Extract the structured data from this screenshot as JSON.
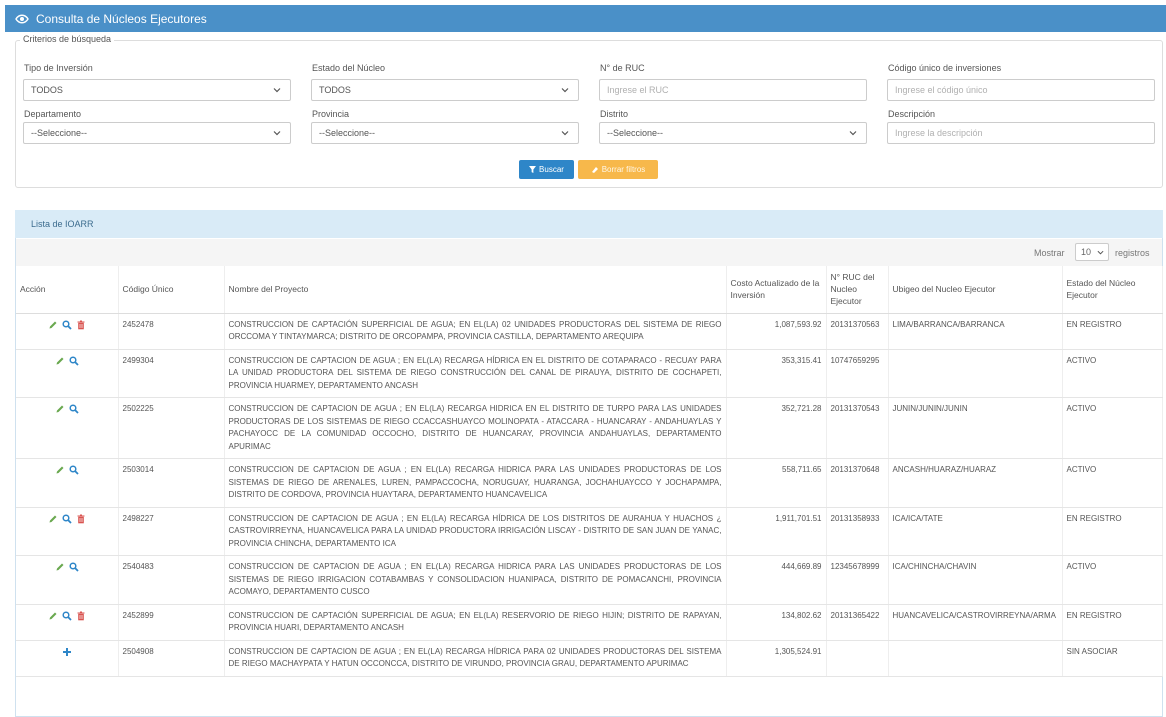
{
  "header": {
    "title": "Consulta de Núcleos Ejecutores"
  },
  "filters": {
    "legend": "Criterios de búsqueda",
    "tipo_inversion": {
      "label": "Tipo de Inversión",
      "value": "TODOS"
    },
    "estado_nucleo": {
      "label": "Estado del Núcleo",
      "value": "TODOS"
    },
    "ruc": {
      "label": "N° de RUC",
      "placeholder": "Ingrese el RUC"
    },
    "codigo": {
      "label": "Código único de inversiones",
      "placeholder": "Ingrese el código único"
    },
    "departamento": {
      "label": "Departamento",
      "value": "--Seleccione--"
    },
    "provincia": {
      "label": "Provincia",
      "value": "--Seleccione--"
    },
    "distrito": {
      "label": "Distrito",
      "value": "--Seleccione--"
    },
    "descripcion": {
      "label": "Descripción",
      "placeholder": "Ingrese la descripción"
    },
    "buscar_label": "Buscar",
    "borrar_label": "Borrar filtros"
  },
  "list": {
    "title": "Lista de IOARR",
    "mostrar": "Mostrar",
    "page_size": "10",
    "registros": "registros",
    "columns": {
      "accion": "Acción",
      "codigo": "Código Único",
      "nombre": "Nombre del Proyecto",
      "costo": "Costo Actualizado de la Inversión",
      "ruc": "N° RUC del Nucleo Ejecutor",
      "ubigeo": "Ubigeo del Nucleo Ejecutor",
      "estado": "Estado del Núcleo Ejecutor"
    },
    "rows": [
      {
        "actions": [
          "edit",
          "view",
          "delete"
        ],
        "codigo": "2452478",
        "nombre": "CONSTRUCCION DE CAPTACIÓN SUPERFICIAL DE AGUA; EN EL(LA) 02 UNIDADES PRODUCTORAS DEL SISTEMA DE RIEGO ORCCOMA Y TINTAYMARCA; DISTRITO DE ORCOPAMPA, PROVINCIA CASTILLA, DEPARTAMENTO AREQUIPA",
        "costo": "1,087,593.92",
        "ruc": "20131370563",
        "ubigeo": "LIMA/BARRANCA/BARRANCA",
        "estado": "EN REGISTRO"
      },
      {
        "actions": [
          "edit",
          "view"
        ],
        "codigo": "2499304",
        "nombre": "CONSTRUCCION DE CAPTACION DE AGUA ; EN EL(LA) RECARGA HÍDRICA EN EL DISTRITO DE COTAPARACO - RECUAY PARA LA UNIDAD PRODUCTORA DEL SISTEMA DE RIEGO CONSTRUCCIÓN DEL CANAL DE PIRAUYA, DISTRITO DE COCHAPETI, PROVINCIA HUARMEY, DEPARTAMENTO ANCASH",
        "costo": "353,315.41",
        "ruc": "10747659295",
        "ubigeo": "",
        "estado": "ACTIVO"
      },
      {
        "actions": [
          "edit",
          "view"
        ],
        "codigo": "2502225",
        "nombre": "CONSTRUCCION DE CAPTACION DE AGUA ; EN EL(LA) RECARGA HIDRICA EN EL DISTRITO DE TURPO PARA LAS UNIDADES PRODUCTORAS DE LOS SISTEMAS DE RIEGO CCACCASHUAYCO MOLINOPATA - ATACCARA - HUANCARAY - ANDAHUAYLAS Y PACHAYOCC DE LA COMUNIDAD OCCOCHO, DISTRITO DE HUANCARAY, PROVINCIA ANDAHUAYLAS, DEPARTAMENTO APURIMAC",
        "costo": "352,721.28",
        "ruc": "20131370543",
        "ubigeo": "JUNIN/JUNIN/JUNIN",
        "estado": "ACTIVO"
      },
      {
        "actions": [
          "edit",
          "view"
        ],
        "codigo": "2503014",
        "nombre": "CONSTRUCCION DE CAPTACION DE AGUA ; EN EL(LA) RECARGA HIDRICA PARA LAS UNIDADES PRODUCTORAS DE LOS SISTEMAS DE RIEGO DE ARENALES, LUREN, PAMPACCOCHA, NORUGUAY, HUARANGA, JOCHAHUAYCCO Y JOCHAPAMPA, DISTRITO DE CORDOVA, PROVINCIA HUAYTARA, DEPARTAMENTO HUANCAVELICA",
        "costo": "558,711.65",
        "ruc": "20131370648",
        "ubigeo": "ANCASH/HUARAZ/HUARAZ",
        "estado": "ACTIVO"
      },
      {
        "actions": [
          "edit",
          "view",
          "delete"
        ],
        "codigo": "2498227",
        "nombre": "CONSTRUCCION DE CAPTACION DE AGUA ; EN EL(LA) RECARGA HÍDRICA DE LOS DISTRITOS DE AURAHUA Y HUACHOS ¿ CASTROVIRREYNA, HUANCAVELICA PARA LA UNIDAD PRODUCTORA IRRIGACIÓN LISCAY - DISTRITO DE SAN JUAN DE YANAC, PROVINCIA CHINCHA, DEPARTAMENTO ICA",
        "costo": "1,911,701.51",
        "ruc": "20131358933",
        "ubigeo": "ICA/ICA/TATE",
        "estado": "EN REGISTRO"
      },
      {
        "actions": [
          "edit",
          "view"
        ],
        "codigo": "2540483",
        "nombre": "CONSTRUCCION DE CAPTACION DE AGUA ; EN EL(LA) RECARGA HIDRICA PARA LAS UNIDADES PRODUCTORAS DE LOS SISTEMAS DE RIEGO IRRIGACION COTABAMBAS Y CONSOLIDACION HUANIPACA, DISTRITO DE POMACANCHI, PROVINCIA ACOMAYO, DEPARTAMENTO CUSCO",
        "costo": "444,669.89",
        "ruc": "12345678999",
        "ubigeo": "ICA/CHINCHA/CHAVIN",
        "estado": "ACTIVO"
      },
      {
        "actions": [
          "edit",
          "view",
          "delete"
        ],
        "codigo": "2452899",
        "nombre": "CONSTRUCCION DE CAPTACIÓN SUPERFICIAL DE AGUA; EN EL(LA) RESERVORIO DE RIEGO HIJIN; DISTRITO DE RAPAYAN, PROVINCIA HUARI, DEPARTAMENTO ANCASH",
        "costo": "134,802.62",
        "ruc": "20131365422",
        "ubigeo": "HUANCAVELICA/CASTROVIRREYNA/ARMA",
        "estado": "EN REGISTRO"
      },
      {
        "actions": [
          "add"
        ],
        "codigo": "2504908",
        "nombre": "CONSTRUCCION DE CAPTACION DE AGUA ; EN EL(LA) RECARGA HÍDRICA PARA 02 UNIDADES PRODUCTORAS DEL SISTEMA DE RIEGO MACHAYPATA Y HATUN OCCONCCA, DISTRITO DE VIRUNDO, PROVINCIA GRAU, DEPARTAMENTO APURIMAC",
        "costo": "1,305,524.91",
        "ruc": "",
        "ubigeo": "",
        "estado": "SIN ASOCIAR"
      }
    ]
  },
  "colors": {
    "header_bg": "#4a90c8",
    "primary": "#2e86c8",
    "warning": "#f7b84b",
    "edit": "#6aa84f",
    "view": "#2e86c8",
    "delete": "#d9534f"
  }
}
